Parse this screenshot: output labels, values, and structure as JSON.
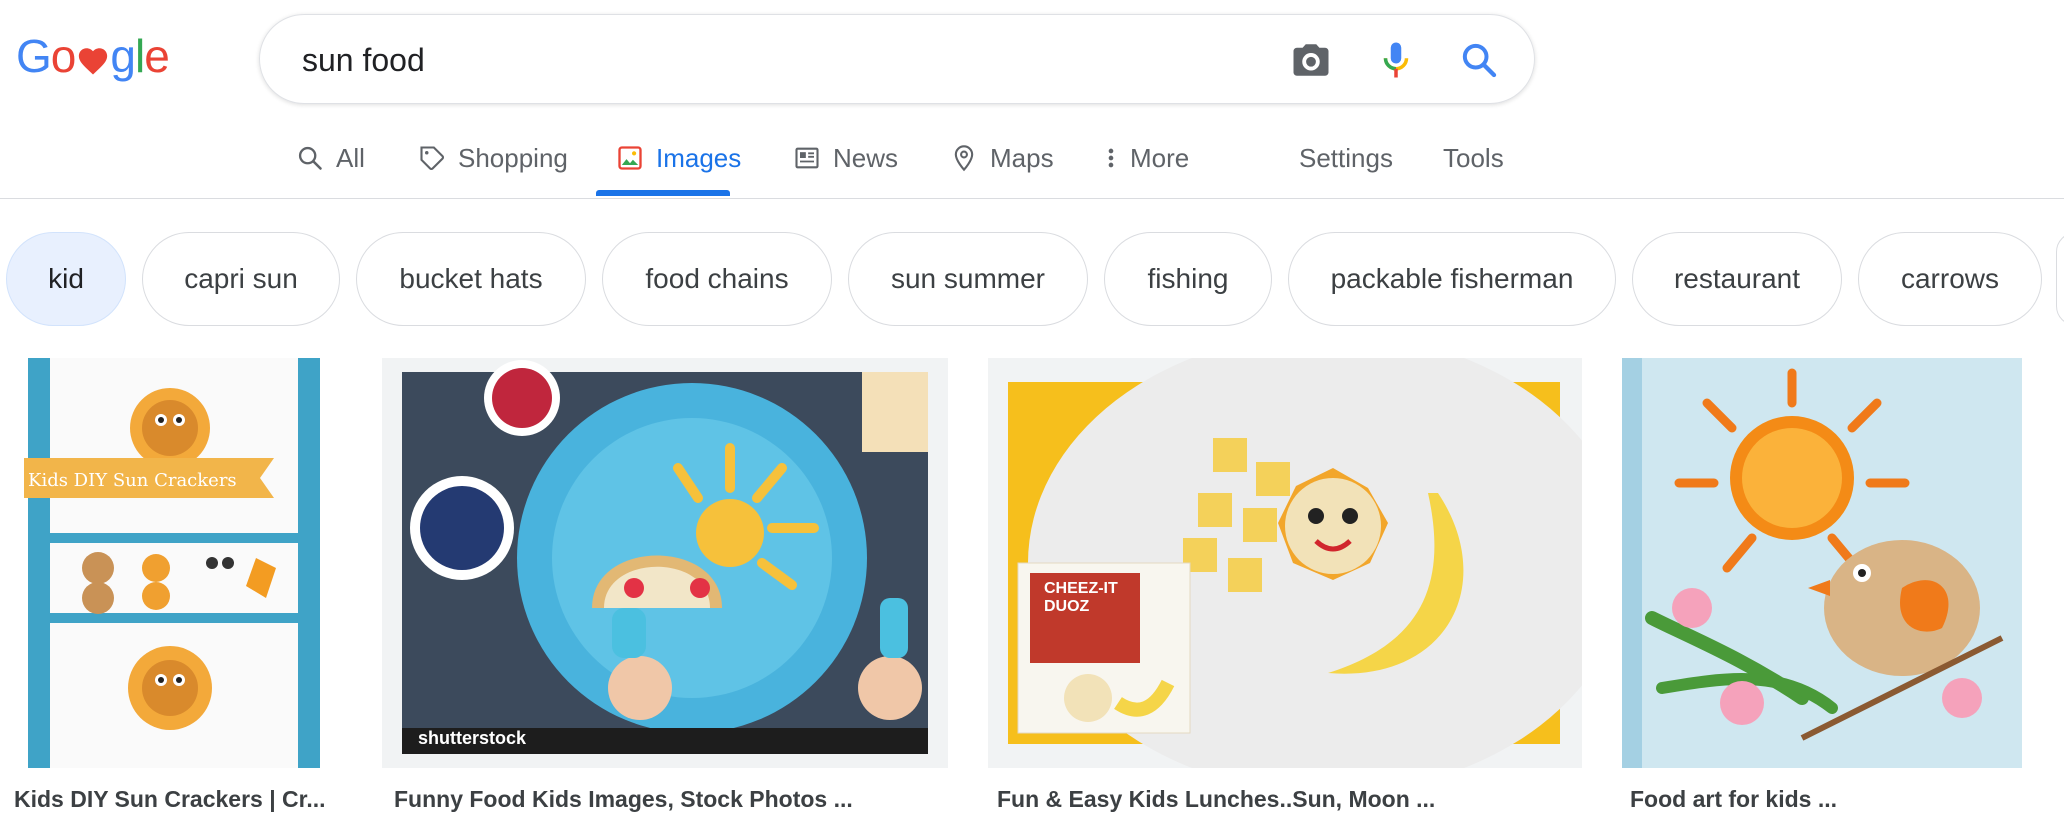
{
  "logo": {
    "letters": [
      "G",
      "o",
      "g",
      "l",
      "e"
    ],
    "colors": [
      "#4285F4",
      "#EA4335",
      "#4285F4",
      "#34A853",
      "#EA4335"
    ],
    "heart_color": "#EA4335",
    "heart_icon": "heart-icon"
  },
  "search": {
    "query": "sun food",
    "icons": [
      "camera-icon",
      "microphone-icon",
      "search-icon"
    ]
  },
  "tabs": [
    {
      "label": "All",
      "icon": "search-icon",
      "active": false
    },
    {
      "label": "Shopping",
      "icon": "tag-icon",
      "active": false
    },
    {
      "label": "Images",
      "icon": "image-icon",
      "active": true
    },
    {
      "label": "News",
      "icon": "newspaper-icon",
      "active": false
    },
    {
      "label": "Maps",
      "icon": "map-pin-icon",
      "active": false
    },
    {
      "label": "More",
      "icon": "more-vert-icon",
      "active": false
    }
  ],
  "tools": {
    "settings": "Settings",
    "tools": "Tools"
  },
  "chips": [
    "kid",
    "capri sun",
    "bucket hats",
    "food chains",
    "sun summer",
    "fishing",
    "packable fisherman",
    "restaurant",
    "carrows"
  ],
  "selected_chip": "kid",
  "results": [
    {
      "caption": "Kids DIY Sun Crackers | Cr...",
      "image_banner_text": "Kids DIY Sun Crackers"
    },
    {
      "caption": "Funny Food Kids Images, Stock Photos ...",
      "watermark": "shutterstock"
    },
    {
      "caption": "Fun & Easy Kids Lunches..Sun, Moon ...",
      "product_text": "CHEEZ-IT DUOZ"
    },
    {
      "caption": "Food art for kids ..."
    }
  ],
  "colors": {
    "accent": "#1a73e8",
    "chip_selected_bg": "#e8f0fe"
  }
}
